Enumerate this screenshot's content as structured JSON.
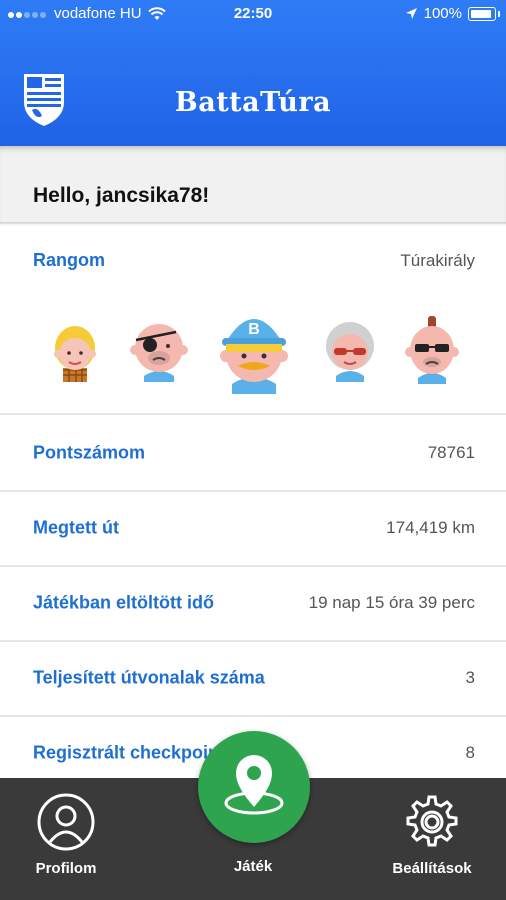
{
  "status_bar": {
    "carrier": "vodafone HU",
    "time": "22:50",
    "battery": "100%"
  },
  "header": {
    "title": "BattaTúra"
  },
  "greeting": "Hello, jancsika78!",
  "rank": {
    "label": "Rangom",
    "value": "Túrakirály"
  },
  "stats": [
    {
      "label": "Pontszámom",
      "value": "78761"
    },
    {
      "label": "Megtett út",
      "value": "174,419 km"
    },
    {
      "label": "Játékban eltöltött idő",
      "value": "19 nap 15 óra 39 perc"
    },
    {
      "label": "Teljesített útvonalak száma",
      "value": "3"
    },
    {
      "label": "Regisztrált checkpoint",
      "value": "8"
    }
  ],
  "tabbar": {
    "profile": "Profilom",
    "game": "Játék",
    "settings": "Beállítások"
  },
  "colors": {
    "header_blue": "#2167e8",
    "accent_blue": "#1f6fd2",
    "fab_green": "#2fa44f",
    "tabbar_bg": "#3a3a3a"
  }
}
